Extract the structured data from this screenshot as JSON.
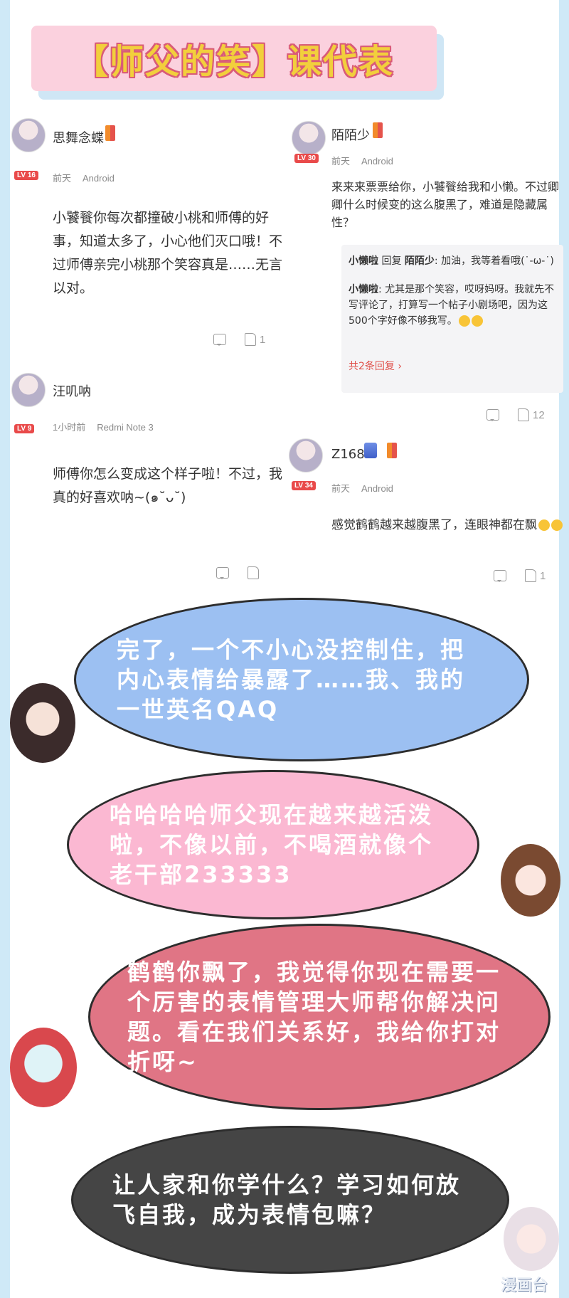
{
  "title": "【师父的笑】课代表",
  "comments": [
    {
      "user": "思舞念蝶",
      "level": "LV 16",
      "badge_num": "8",
      "time": "前天",
      "device": "Android",
      "text": "小饕餮你每次都撞破小桃和师傅的好事，知道太多了，小心他们灭口哦！不过师傅亲完小桃那个笑容真是……无言以对。",
      "likes": "1"
    },
    {
      "user": "陌陌少",
      "level": "LV 30",
      "badge_num": "8",
      "time": "前天",
      "device": "Android",
      "text": "来来来票票给你，小饕餮给我和小懒。不过卿卿什么时候变的这么腹黑了，难道是隐藏属性？",
      "likes": "12",
      "replies": [
        {
          "user": "小懒啦",
          "action": "回复",
          "target": "陌陌少",
          "text": ": 加油，我等着看哦(˙-ω-˙)"
        },
        {
          "user": "小懒啦",
          "text": ": 尤其是那个笑容，哎呀妈呀。我就先不写评论了，打算写一个帖子小剧场吧，因为这500个字好像不够我写。"
        }
      ],
      "more_replies": "共2条回复 ›"
    },
    {
      "user": "汪叽呐",
      "level": "LV 9",
      "time": "1小时前",
      "device": "Redmi Note 3",
      "text": "师傅你怎么变成这个样子啦！不过，我真的好喜欢呐~(๑˘ᴗ˘)",
      "likes": ""
    },
    {
      "user": "Z168",
      "level": "LV 34",
      "badge_num": "5",
      "badge_num2": "9",
      "time": "前天",
      "device": "Android",
      "text": "感觉鹤鹤越来越腹黑了，连眼神都在飘",
      "likes": "1"
    }
  ],
  "bubbles": [
    {
      "text": "完了，一个不小心没控制住，把内心表情给暴露了……我、我的一世英名QAQ",
      "color": "#9cc0f2",
      "text_color": "#ffffff"
    },
    {
      "text": "哈哈哈哈师父现在越来越活泼啦，不像以前，不喝酒就像个老干部233333",
      "color": "#fbb8d2",
      "text_color": "#ffffff"
    },
    {
      "text": "鹤鹤你飘了，我觉得你现在需要一个厉害的表情管理大师帮你解决问题。看在我们关系好，我给你打对折呀~",
      "color": "#e07585",
      "text_color": "#ffffff"
    },
    {
      "text": "让人家和你学什么？学习如何放飞自我，成为表情包嘛？",
      "color": "#454545",
      "text_color": "#ffffff"
    }
  ],
  "watermark": "漫画台",
  "colors": {
    "title_bg": "#fbd1de",
    "title_text": "#f2cf3c",
    "link": "#e0504a",
    "level": "#e94a4a"
  }
}
